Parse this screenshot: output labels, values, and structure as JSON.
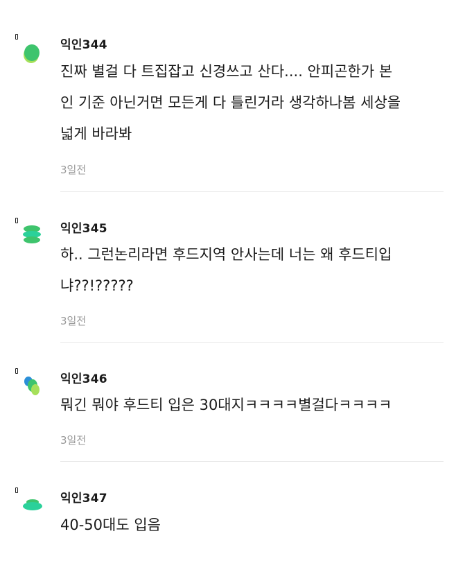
{
  "comments": [
    {
      "author": "익인344",
      "lines": [
        "진짜 별걸 다 트집잡고 신경쓰고 산다.... 안피곤한가 본",
        "인 기준 아닌거면 모든게 다 틀린거라 생각하나봄 세상을",
        "넓게 바라봐"
      ],
      "time": "3일전",
      "avatar": "green-blob-icon"
    },
    {
      "author": "익인345",
      "lines": [
        "하.. 그런논리라면 후드지역 안사는데 너는 왜 후드티입",
        "냐??!?????"
      ],
      "time": "3일전",
      "avatar": "green-stack-icon"
    },
    {
      "author": "익인346",
      "lines": [
        "뭐긴 뭐야 후드티 입은 30대지ㅋㅋㅋㅋ별걸다ㅋㅋㅋㅋ"
      ],
      "time": "3일전",
      "avatar": "green-blue-bubbles-icon"
    },
    {
      "author": "익인347",
      "lines": [
        "40-50대도 입음"
      ],
      "avatar": "green-disc-icon"
    }
  ],
  "colors": {
    "green": "#3ec46d",
    "light_green": "#a6e05a",
    "teal": "#2bd19a",
    "blue": "#2b8fd8"
  }
}
